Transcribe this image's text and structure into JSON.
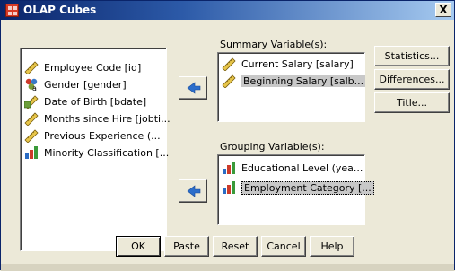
{
  "window": {
    "title": "OLAP Cubes",
    "close_glyph": "X"
  },
  "source_list": {
    "items": [
      {
        "icon": "ruler-scale-icon",
        "label": "Employee Code [id]"
      },
      {
        "icon": "nominal-people-icon",
        "label": "Gender [gender]"
      },
      {
        "icon": "ruler-date-icon",
        "label": "Date of Birth [bdate]"
      },
      {
        "icon": "ruler-scale-icon",
        "label": "Months since Hire [jobti..."
      },
      {
        "icon": "ruler-scale-icon",
        "label": "Previous Experience (..."
      },
      {
        "icon": "ordinal-bars-icon",
        "label": "Minority Classification [..."
      }
    ]
  },
  "summary": {
    "label": "Summary Variable(s):",
    "items": [
      {
        "icon": "ruler-scale-icon",
        "label": "Current Salary [salary]"
      },
      {
        "icon": "ruler-scale-icon",
        "label": "Beginning Salary [salb..."
      }
    ]
  },
  "grouping": {
    "label": "Grouping Variable(s):",
    "items": [
      {
        "icon": "ordinal-bars-icon",
        "label": "Educational Level (yea..."
      },
      {
        "icon": "ordinal-bars-icon",
        "label": "Employment Category [..."
      }
    ]
  },
  "side_buttons": {
    "statistics": "Statistics...",
    "differences": "Differences...",
    "title": "Title..."
  },
  "bottom_buttons": {
    "ok": "OK",
    "paste": "Paste",
    "reset": "Reset",
    "cancel": "Cancel",
    "help": "Help"
  },
  "colors": {
    "title_gradient_start": "#0a246a",
    "dialog_bg": "#ece9d8",
    "arrow_blue": "#2c6ecb"
  }
}
